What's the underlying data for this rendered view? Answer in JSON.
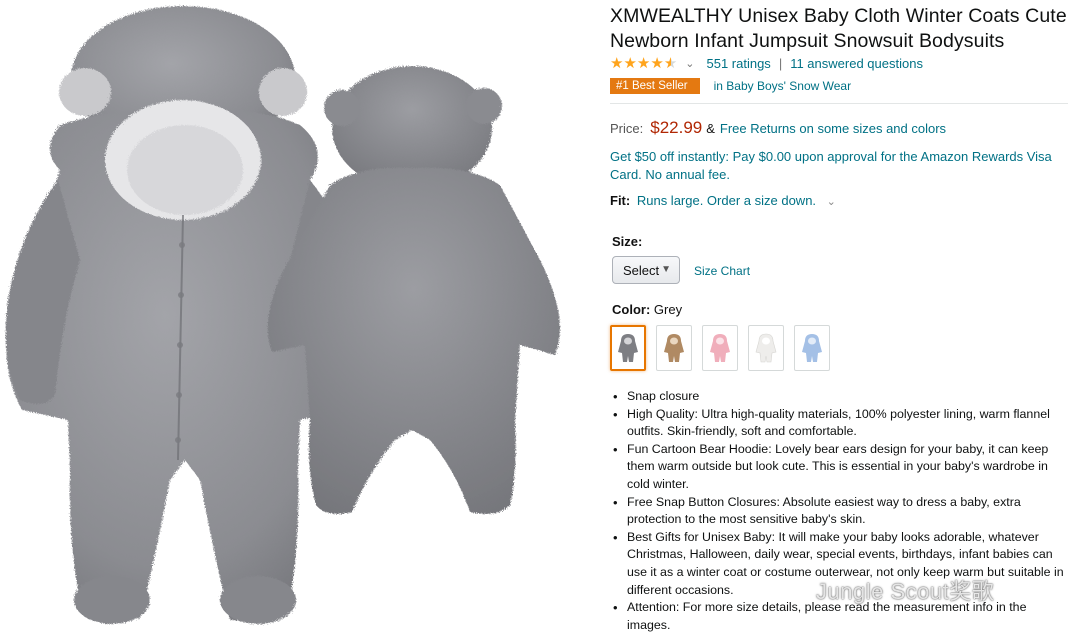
{
  "product": {
    "title": "XMWEALTHY Unisex Baby Cloth Winter Coats Cute Newborn Infant Jumpsuit Snowsuit Bodysuits",
    "ratings": "551 ratings",
    "separator": "|",
    "questions": "11 answered questions",
    "rating_value": 4.5,
    "badge": "#1 Best Seller",
    "badge_category": "in Baby Boys' Snow Wear",
    "price_label": "Price:",
    "price": "$22.99",
    "price_amp": "&",
    "free_returns": "Free Returns on some sizes and colors",
    "promo": "Get $50 off instantly: Pay $0.00 upon approval for the Amazon Rewards Visa Card. No annual fee.",
    "fit_label": "Fit:",
    "fit_value": "Runs large. Order a size down.",
    "size_label": "Size:",
    "size_select": "Select",
    "size_chart": "Size Chart",
    "color_label": "Color:",
    "color_value": "Grey",
    "swatches": [
      {
        "name": "Grey",
        "color": "#8e8f94"
      },
      {
        "name": "Brown",
        "color": "#b8946e"
      },
      {
        "name": "Pink",
        "color": "#f2b8c2"
      },
      {
        "name": "White",
        "color": "#f1f0ee"
      },
      {
        "name": "Blue",
        "color": "#a9c4e8"
      }
    ],
    "bullets": [
      "Snap closure",
      "High Quality: Ultra high-quality materials, 100% polyester lining, warm flannel outfits. Skin-friendly, soft and comfortable.",
      "Fun Cartoon Bear Hoodie: Lovely bear ears design for your baby, it can keep them warm outside but look cute. This is essential in your baby's wardrobe in cold winter.",
      "Free Snap Button Closures: Absolute easiest way to dress a baby, extra protection to the most sensitive baby's skin.",
      "Best Gifts for Unisex Baby: It will make your baby looks adorable, whatever Christmas, Halloween, daily wear, special events, birthdays, infant babies can use it as a winter coat or costume outerwear, not only keep warm but suitable in different occasions.",
      "Attention: For more size details, please read the measurement info in the images."
    ]
  },
  "watermark": "Jungle Scout奖歌",
  "colors": {
    "link": "#007185",
    "price": "#b12704",
    "badge": "#e47911",
    "star": "#ffa41c",
    "fleece": "#8a8b90"
  }
}
